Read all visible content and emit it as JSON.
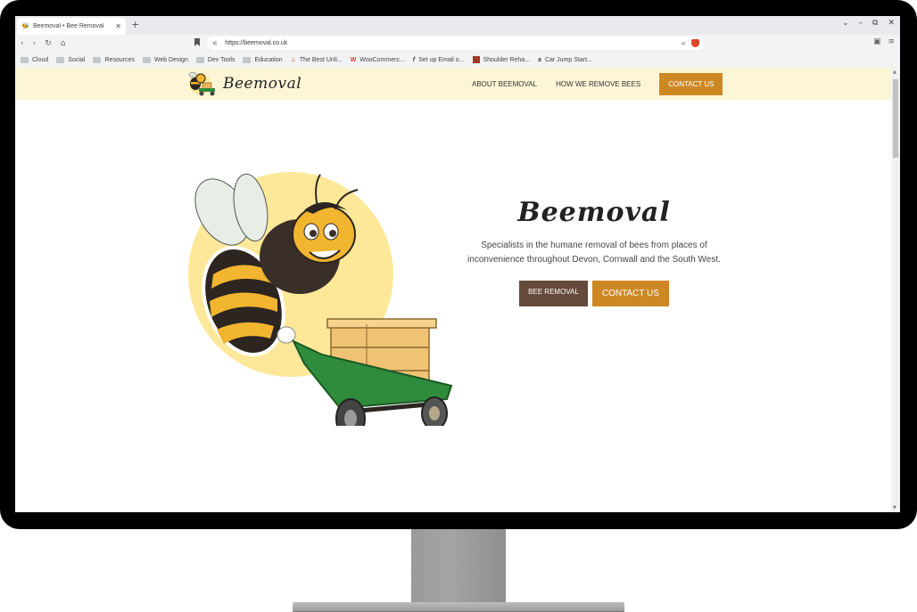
{
  "browser": {
    "tab_title": "Beemoval • Bee Removal",
    "tab_close": "✕",
    "new_tab": "+",
    "window_controls": [
      "⌄",
      "–",
      "⧉",
      "✕"
    ],
    "nav_icons": [
      "back-icon",
      "forward-icon",
      "reload-icon",
      "home-icon"
    ],
    "url": "https://beemoval.co.uk",
    "bookmarks": [
      {
        "label": "Cloud",
        "icon": "folder-icon"
      },
      {
        "label": "Social",
        "icon": "folder-icon"
      },
      {
        "label": "Resources",
        "icon": "folder-icon"
      },
      {
        "label": "Web Design",
        "icon": "folder-icon"
      },
      {
        "label": "Dev Tools",
        "icon": "folder-icon"
      },
      {
        "label": "Education",
        "icon": "folder-icon"
      },
      {
        "label": "The Best Unli...",
        "icon": "flame-icon"
      },
      {
        "label": "WooCommerc...",
        "icon": "woocommerce-icon"
      },
      {
        "label": "Set up Email o...",
        "icon": "facebook-icon"
      },
      {
        "label": "Shoulder Reha...",
        "icon": "site-icon"
      },
      {
        "label": "Car Jump Start...",
        "icon": "amazon-icon"
      }
    ]
  },
  "site": {
    "logo_text": "Beemoval",
    "nav": {
      "about": "ABOUT BEEMOVAL",
      "how": "HOW WE REMOVE BEES",
      "contact": "CONTACT US"
    },
    "hero": {
      "title": "Beemoval",
      "subtitle_line1": "Specialists in the humane removal of bees from places of",
      "subtitle_line2": "inconvenience throughout Devon, Cornwall and the South West.",
      "btn_removal": "BEE REMOVAL",
      "btn_contact": "CONTACT US"
    }
  },
  "colors": {
    "header_bg": "#fdf6d6",
    "accent_orange": "#cd8824",
    "accent_brown": "#654a3c",
    "sun_yellow": "#fde89a"
  }
}
